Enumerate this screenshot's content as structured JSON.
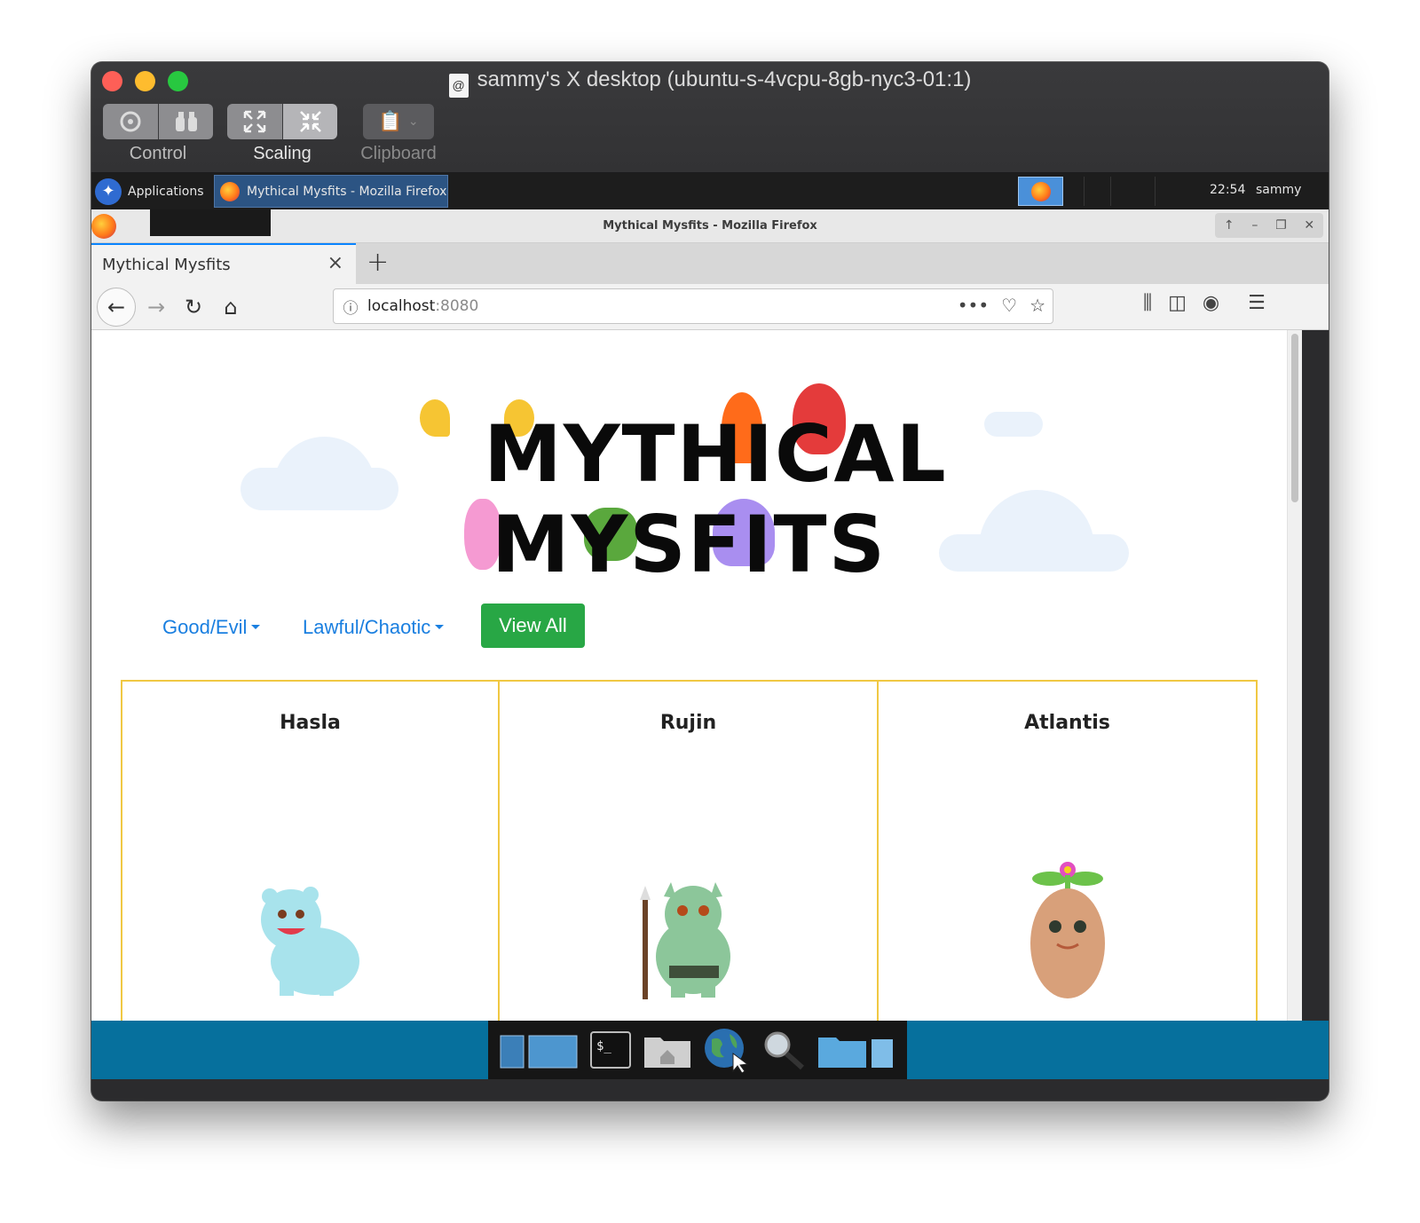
{
  "mac": {
    "title": "sammy's X desktop (ubuntu-s-4vcpu-8gb-nyc3-01:1)",
    "toolbar": {
      "control_label": "Control",
      "scaling_label": "Scaling",
      "clipboard_label": "Clipboard"
    }
  },
  "panel": {
    "applications_label": "Applications",
    "task_label": "Mythical Mysfits - Mozilla Firefox",
    "clock": "22:54",
    "user": "sammy"
  },
  "firefox": {
    "window_title": "Mythical Mysfits - Mozilla Firefox",
    "tab_title": "Mythical Mysfits",
    "url_host": "localhost",
    "url_port": ":8080"
  },
  "page": {
    "logo_line1": "MYTHICAL",
    "logo_line2": "MYSFITS",
    "filters": {
      "good_evil": "Good/Evil",
      "lawful_chaotic": "Lawful/Chaotic",
      "view_all": "View All"
    },
    "mysfits": [
      {
        "name": "Hasla"
      },
      {
        "name": "Rujin"
      },
      {
        "name": "Atlantis"
      }
    ]
  },
  "colors": {
    "link": "#1a7fe0",
    "view_all_bg": "#28a745",
    "card_border": "#f0c843",
    "dock_bar": "#06709d"
  }
}
